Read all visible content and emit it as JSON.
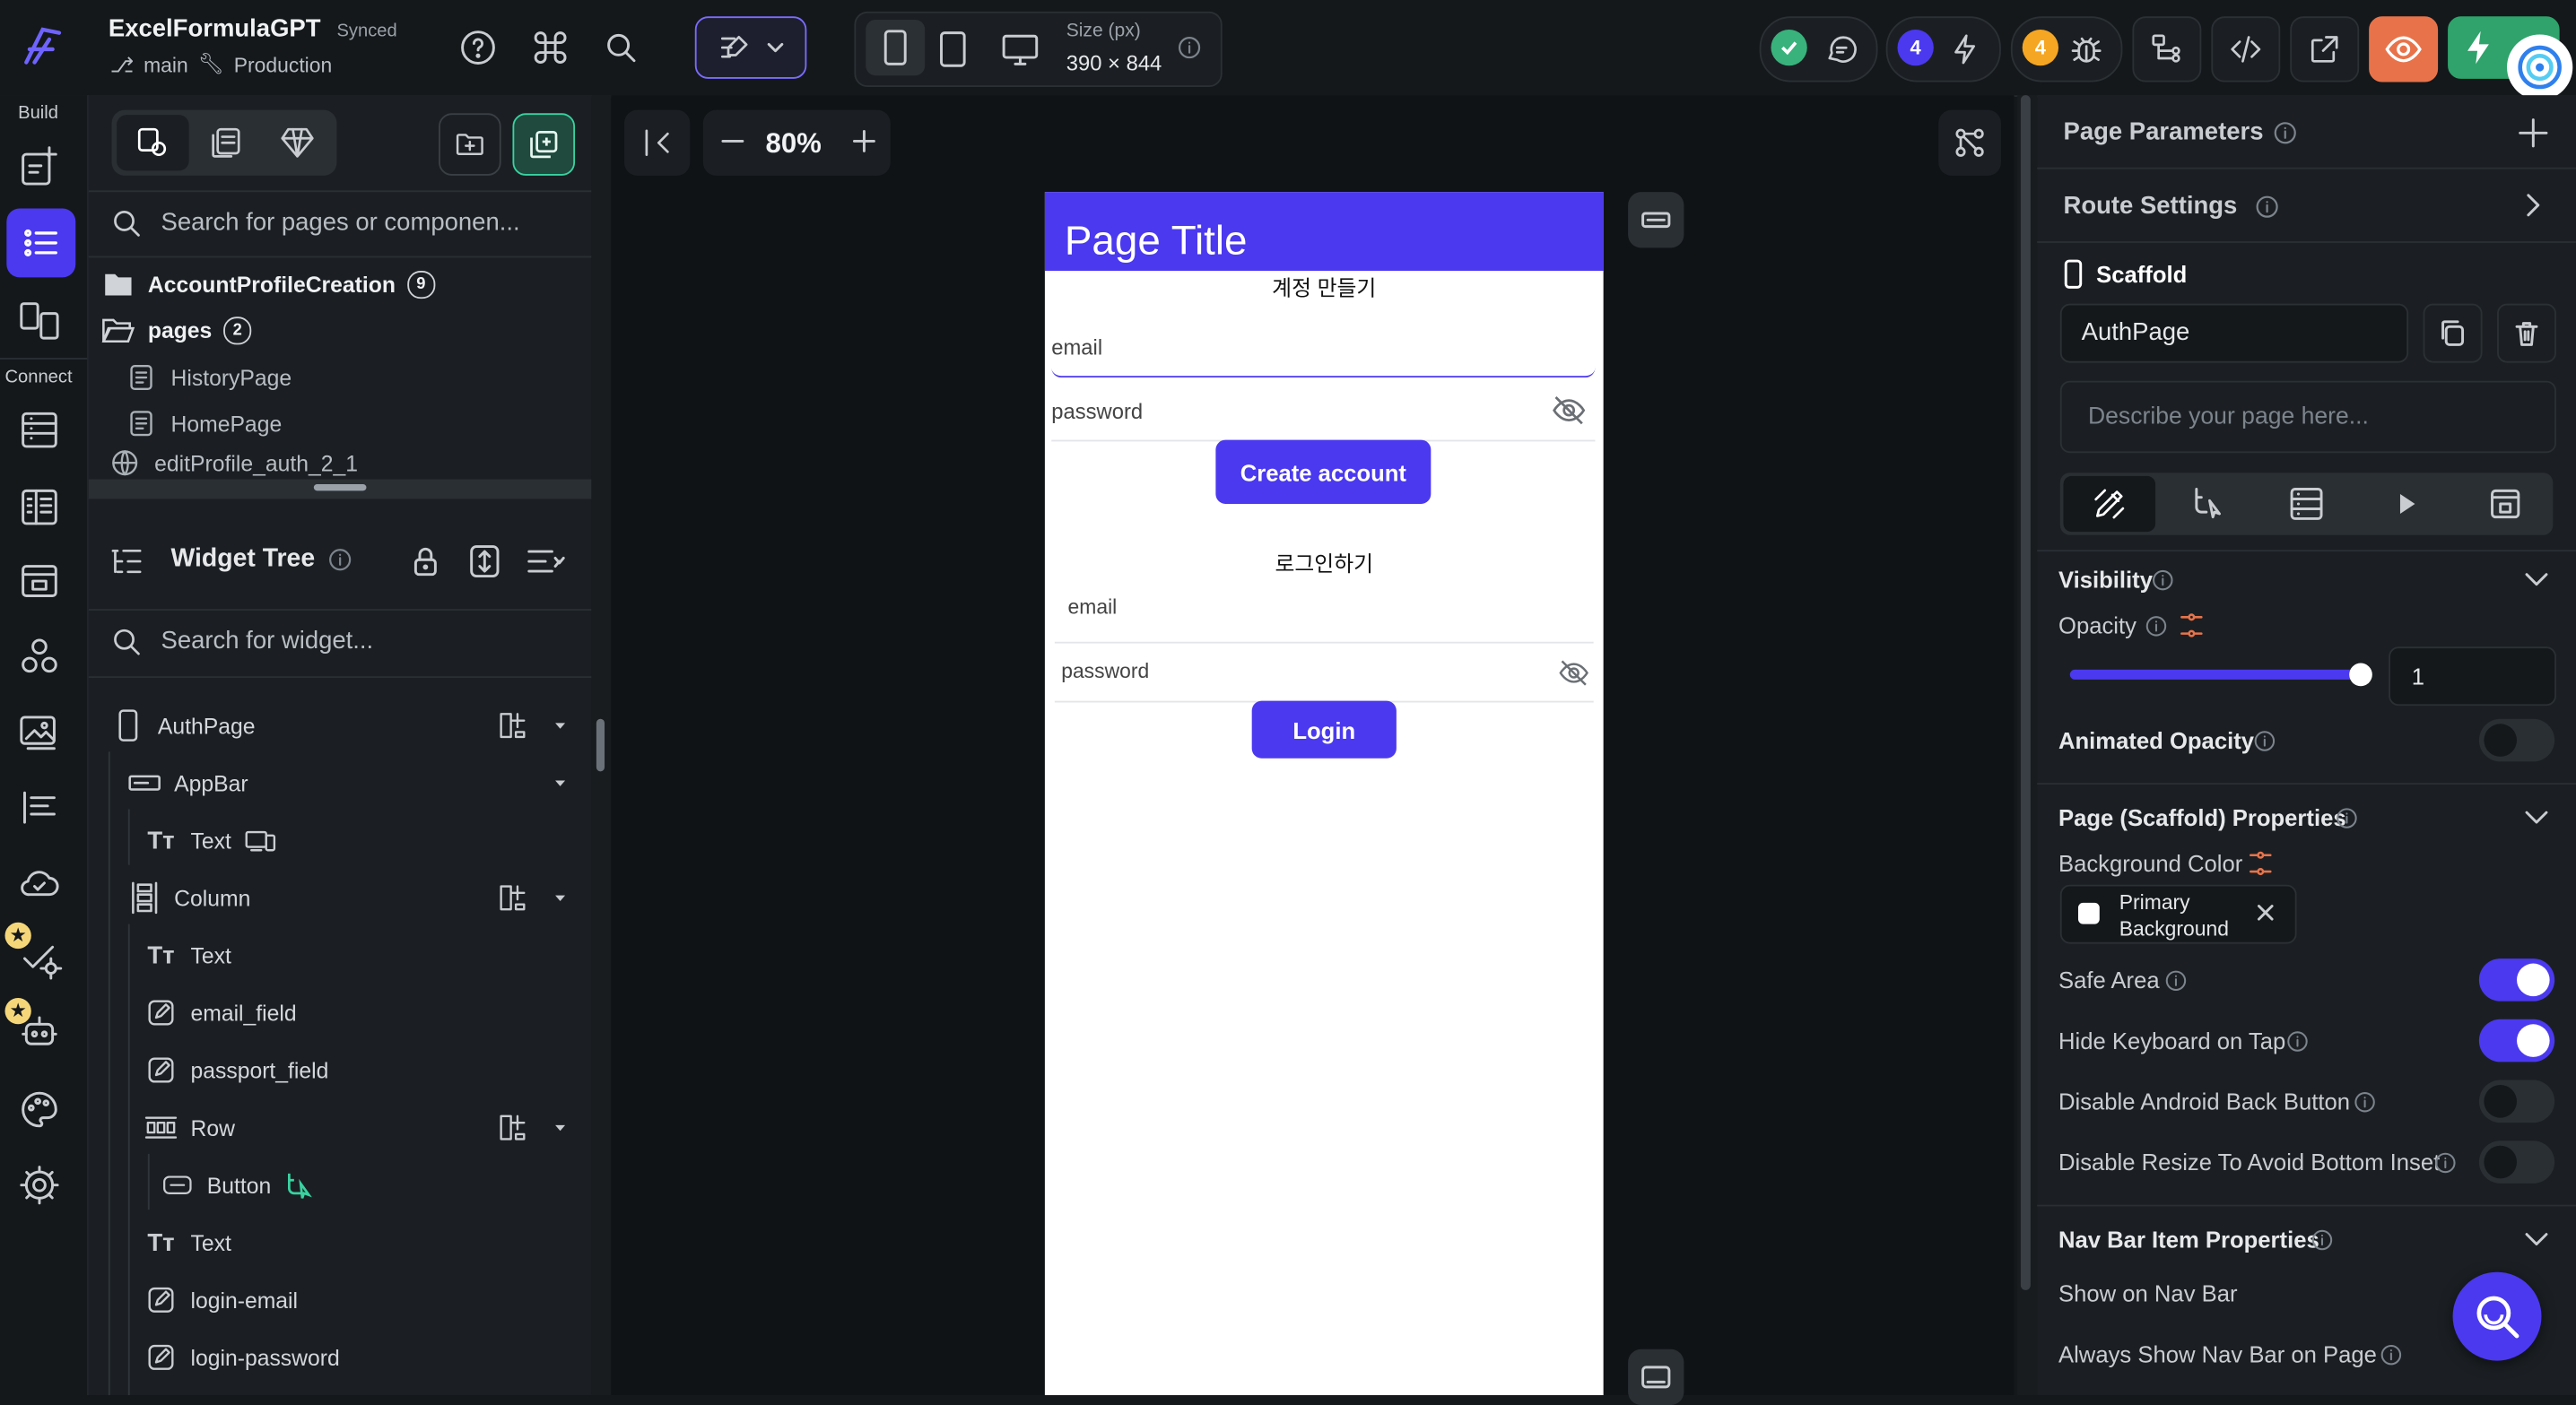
{
  "project": {
    "name": "ExcelFormulaGPT",
    "sync_status": "Synced",
    "branch": "main",
    "environment": "Production"
  },
  "toolbar": {
    "size_label": "Size (px)",
    "size_value": "390 × 844",
    "zoom": "80%",
    "agents_count": "4",
    "issues_count": "4"
  },
  "rail": {
    "build_label": "Build",
    "connect_label": "Connect"
  },
  "page_tree": {
    "search_placeholder": "Search for pages or componen...",
    "folders": [
      {
        "label": "AccountProfileCreation",
        "count": "9"
      },
      {
        "label": "pages",
        "count": "2"
      }
    ],
    "pages": [
      "HistoryPage",
      "HomePage",
      "editProfile_auth_2_1"
    ]
  },
  "widget_tree": {
    "title": "Widget Tree",
    "search_placeholder": "Search for widget...",
    "nodes": [
      {
        "label": "AuthPage",
        "icon": "phone-icon"
      },
      {
        "label": "AppBar",
        "icon": "appbar-icon"
      },
      {
        "label": "Text",
        "icon": "text-icon"
      },
      {
        "label": "Column",
        "icon": "column-icon"
      },
      {
        "label": "Text",
        "icon": "text-icon"
      },
      {
        "label": "email_field",
        "icon": "edit-icon"
      },
      {
        "label": "passport_field",
        "icon": "edit-icon"
      },
      {
        "label": "Row",
        "icon": "row-icon"
      },
      {
        "label": "Button",
        "icon": "button-icon"
      },
      {
        "label": "Text",
        "icon": "text-icon"
      },
      {
        "label": "login-email",
        "icon": "edit-icon"
      },
      {
        "label": "login-password",
        "icon": "edit-icon"
      }
    ]
  },
  "preview": {
    "app_bar_title": "Page Title",
    "signup_heading": "계정 만들기",
    "email_hint": "email",
    "password_hint": "password",
    "create_button": "Create account",
    "login_heading": "로그인하기",
    "login_email_hint": "email",
    "login_password_hint": "password",
    "login_button": "Login",
    "primary_color": "#4b39ef"
  },
  "properties": {
    "page_parameters": "Page Parameters",
    "route_settings": "Route Settings",
    "widget_type": "Scaffold",
    "page_name": "AuthPage",
    "description_placeholder": "Describe your page here...",
    "visibility_title": "Visibility",
    "opacity_label": "Opacity",
    "opacity_value": "1",
    "opacity_fraction": 1,
    "animated_opacity_label": "Animated Opacity",
    "scaffold_title": "Page (Scaffold) Properties",
    "background_color_label": "Background Color",
    "background_color_value": "Primary Background",
    "safe_area_label": "Safe Area",
    "hide_keyboard_label": "Hide Keyboard on Tap",
    "disable_back_label": "Disable Android Back Button",
    "disable_resize_label": "Disable Resize To Avoid Bottom Inset",
    "navbar_title": "Nav Bar Item Properties",
    "show_navbar_label": "Show on Nav Bar",
    "always_show_navbar_label": "Always Show Nav Bar on Page",
    "toggles": {
      "animated_opacity": false,
      "safe_area": true,
      "hide_keyboard": true,
      "disable_back": false,
      "disable_resize": false
    }
  }
}
